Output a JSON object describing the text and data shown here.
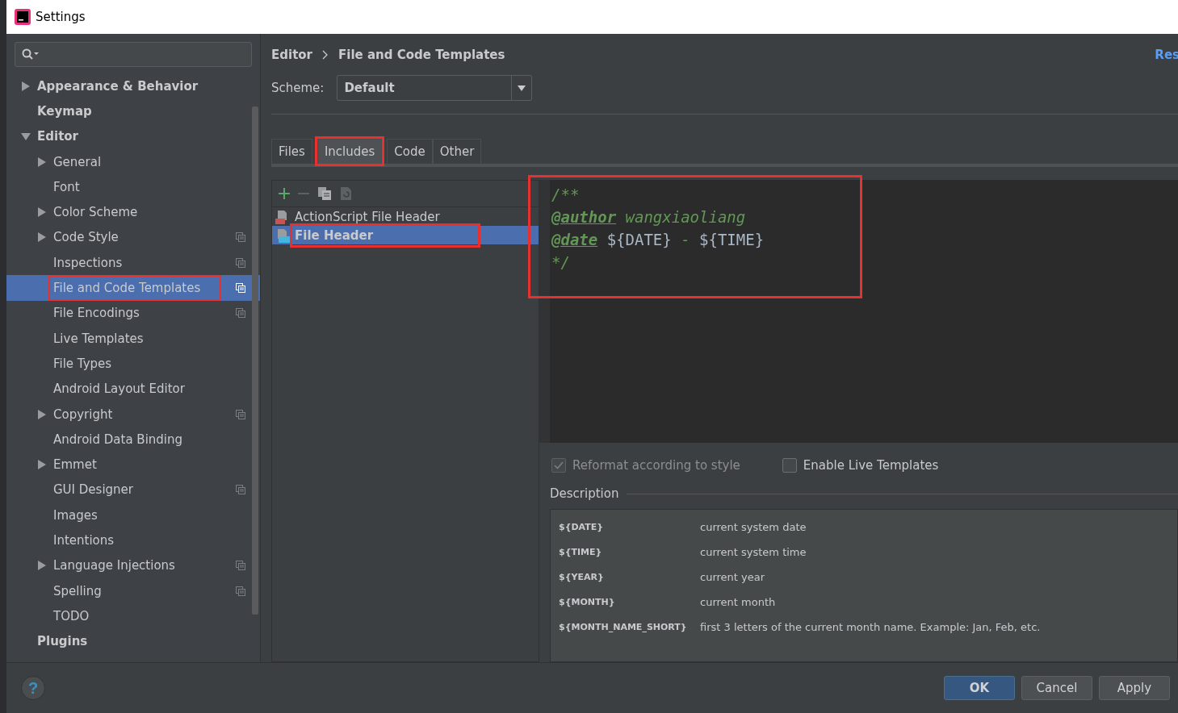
{
  "window": {
    "title": "Settings"
  },
  "sidebar": {
    "items": [
      {
        "label": "Appearance & Behavior",
        "bold": true,
        "expanded": false,
        "selected": false
      },
      {
        "label": "Keymap",
        "bold": true,
        "selected": false
      },
      {
        "label": "Editor",
        "bold": true,
        "expanded": true,
        "selected": false,
        "children": [
          {
            "label": "General",
            "expanded": false,
            "selected": false
          },
          {
            "label": "Font",
            "selected": false
          },
          {
            "label": "Color Scheme",
            "expanded": false,
            "selected": false
          },
          {
            "label": "Code Style",
            "expanded": false,
            "project": true,
            "selected": false
          },
          {
            "label": "Inspections",
            "project": true,
            "selected": false
          },
          {
            "label": "File and Code Templates",
            "project": true,
            "selected": true,
            "marked": true
          },
          {
            "label": "File Encodings",
            "project": true,
            "selected": false
          },
          {
            "label": "Live Templates",
            "selected": false
          },
          {
            "label": "File Types",
            "selected": false
          },
          {
            "label": "Android Layout Editor",
            "selected": false
          },
          {
            "label": "Copyright",
            "expanded": false,
            "project": true,
            "selected": false
          },
          {
            "label": "Android Data Binding",
            "selected": false
          },
          {
            "label": "Emmet",
            "expanded": false,
            "selected": false
          },
          {
            "label": "GUI Designer",
            "project": true,
            "selected": false
          },
          {
            "label": "Images",
            "selected": false
          },
          {
            "label": "Intentions",
            "selected": false
          },
          {
            "label": "Language Injections",
            "expanded": false,
            "project": true,
            "selected": false
          },
          {
            "label": "Spelling",
            "project": true,
            "selected": false
          },
          {
            "label": "TODO",
            "selected": false
          }
        ]
      },
      {
        "label": "Plugins",
        "bold": true,
        "selected": false
      }
    ]
  },
  "breadcrumb": [
    "Editor",
    "File and Code Templates"
  ],
  "reset_link": "Res",
  "scheme": {
    "label": "Scheme:",
    "value": "Default"
  },
  "tabs": [
    {
      "label": "Files",
      "selected": false,
      "marked": false
    },
    {
      "label": "Includes",
      "selected": true,
      "marked": true
    },
    {
      "label": "Code",
      "selected": false,
      "marked": false
    },
    {
      "label": "Other",
      "selected": false,
      "marked": false
    }
  ],
  "templates": [
    {
      "label": "ActionScript File Header",
      "kind": "actionscript",
      "selected": false,
      "marked": false
    },
    {
      "label": "File Header",
      "kind": "java",
      "selected": true,
      "marked": true
    }
  ],
  "editor": {
    "marked": true,
    "lines": [
      [
        {
          "kind": "comment",
          "text": "/**"
        }
      ],
      [
        {
          "kind": "tag",
          "text": "@author"
        },
        {
          "kind": "comment",
          "text": " wangxiaoliang"
        }
      ],
      [
        {
          "kind": "tag",
          "text": "@date"
        },
        {
          "kind": "variable",
          "text": " ${DATE}"
        },
        {
          "kind": "comment",
          "text": " - "
        },
        {
          "kind": "variable",
          "text": "${TIME}"
        }
      ],
      [
        {
          "kind": "comment",
          "text": "*/"
        }
      ]
    ]
  },
  "options": [
    {
      "label": "Reformat according to style",
      "checked": true,
      "disabled": true
    },
    {
      "label": "Enable Live Templates",
      "checked": false,
      "disabled": false
    }
  ],
  "description": {
    "title": "Description",
    "rows": [
      {
        "variable": "${DATE}",
        "text": "current system date"
      },
      {
        "variable": "${TIME}",
        "text": "current system time"
      },
      {
        "variable": "${YEAR}",
        "text": "current year"
      },
      {
        "variable": "${MONTH}",
        "text": "current month"
      },
      {
        "variable": "${MONTH_NAME_SHORT}",
        "text": "first 3 letters of the current month name. Example: Jan, Feb, etc."
      }
    ]
  },
  "help": "?",
  "buttons": [
    {
      "label": "OK",
      "primary": true
    },
    {
      "label": "Cancel",
      "primary": false
    },
    {
      "label": "Apply",
      "primary": false
    }
  ]
}
